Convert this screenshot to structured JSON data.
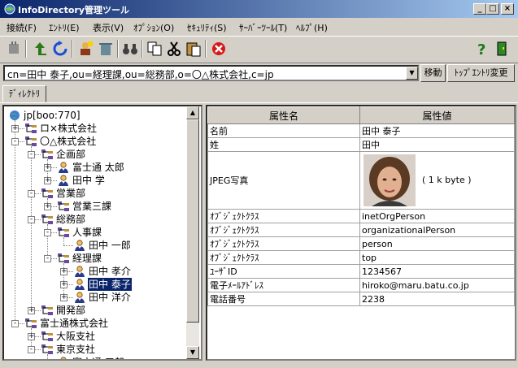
{
  "window": {
    "title": "InfoDirectory管理ツール"
  },
  "menu": [
    "接続(F)",
    "ｴﾝﾄﾘ(E)",
    "表示(V)",
    "ｵﾌﾟｼｮﾝ(O)",
    "ｾｷｭﾘﾃｨ(S)",
    "ｻｰﾊﾞｰﾂｰﾙ(T)",
    "ﾍﾙﾌﾟ(H)"
  ],
  "dn": {
    "value": "cn=田中 泰子,ou=経理課,ou=総務部,o=〇△株式会社,c=jp",
    "move_label": "移動",
    "top_entry_label": "ﾄｯﾌﾟｴﾝﾄﾘ変更"
  },
  "tab": {
    "label": "ﾃﾞｨﾚｸﾄﾘ"
  },
  "tree": [
    {
      "label": "jp[boo:770]",
      "icon": "globe-icon",
      "depth": 0,
      "expander": ""
    },
    {
      "label": "ロ×株式会社",
      "icon": "org-icon",
      "depth": 1,
      "expander": "+"
    },
    {
      "label": "〇△株式会社",
      "icon": "org-icon",
      "depth": 1,
      "expander": "-"
    },
    {
      "label": "企画部",
      "icon": "org-icon",
      "depth": 2,
      "expander": "-"
    },
    {
      "label": "富士通 太郎",
      "icon": "person-icon",
      "depth": 3,
      "expander": "+"
    },
    {
      "label": "田中 学",
      "icon": "person-icon",
      "depth": 3,
      "expander": "+"
    },
    {
      "label": "営業部",
      "icon": "org-icon",
      "depth": 2,
      "expander": "-"
    },
    {
      "label": "営業三課",
      "icon": "org-icon",
      "depth": 3,
      "expander": "+"
    },
    {
      "label": "総務部",
      "icon": "org-icon",
      "depth": 2,
      "expander": "-"
    },
    {
      "label": "人事課",
      "icon": "org-icon",
      "depth": 3,
      "expander": "-"
    },
    {
      "label": "田中 一郎",
      "icon": "person-icon",
      "depth": 4,
      "expander": ""
    },
    {
      "label": "経理課",
      "icon": "org-icon",
      "depth": 3,
      "expander": "-"
    },
    {
      "label": "田中 孝介",
      "icon": "person-icon",
      "depth": 4,
      "expander": "+"
    },
    {
      "label": "田中 泰子",
      "icon": "person-icon",
      "depth": 4,
      "expander": "+",
      "selected": true
    },
    {
      "label": "田中 洋介",
      "icon": "person-icon",
      "depth": 4,
      "expander": "+"
    },
    {
      "label": "開発部",
      "icon": "org-icon",
      "depth": 2,
      "expander": "+"
    },
    {
      "label": "富士通株式会社",
      "icon": "org-icon",
      "depth": 1,
      "expander": "-"
    },
    {
      "label": "大阪支社",
      "icon": "org-icon",
      "depth": 2,
      "expander": "+"
    },
    {
      "label": "東京支社",
      "icon": "org-icon",
      "depth": 2,
      "expander": "-"
    },
    {
      "label": "富士通 三郎",
      "icon": "person-icon",
      "depth": 3,
      "expander": "+"
    }
  ],
  "attributes": {
    "headers": [
      "属性名",
      "属性値"
    ],
    "rows": [
      {
        "name": "名前",
        "value": "田中 泰子"
      },
      {
        "name": "姓",
        "value": "田中"
      },
      {
        "name": "JPEG写真",
        "value": "( 1 k byte )",
        "photo": true
      },
      {
        "name": "ｵﾌﾞｼﾞｪｸﾄｸﾗｽ",
        "value": "inetOrgPerson"
      },
      {
        "name": "ｵﾌﾞｼﾞｪｸﾄｸﾗｽ",
        "value": "organizationalPerson"
      },
      {
        "name": "ｵﾌﾞｼﾞｪｸﾄｸﾗｽ",
        "value": "person"
      },
      {
        "name": "ｵﾌﾞｼﾞｪｸﾄｸﾗｽ",
        "value": "top"
      },
      {
        "name": "ﾕｰｻﾞID",
        "value": "1234567"
      },
      {
        "name": "電子ﾒｰﾙｱﾄﾞﾚｽ",
        "value": "hiroko@maru.batu.co.jp"
      },
      {
        "name": "電話番号",
        "value": "2238"
      }
    ]
  },
  "colors": {
    "title_start": "#0a246a",
    "title_end": "#a6caf0",
    "face": "#d4d0c8",
    "selection": "#0a246a"
  }
}
